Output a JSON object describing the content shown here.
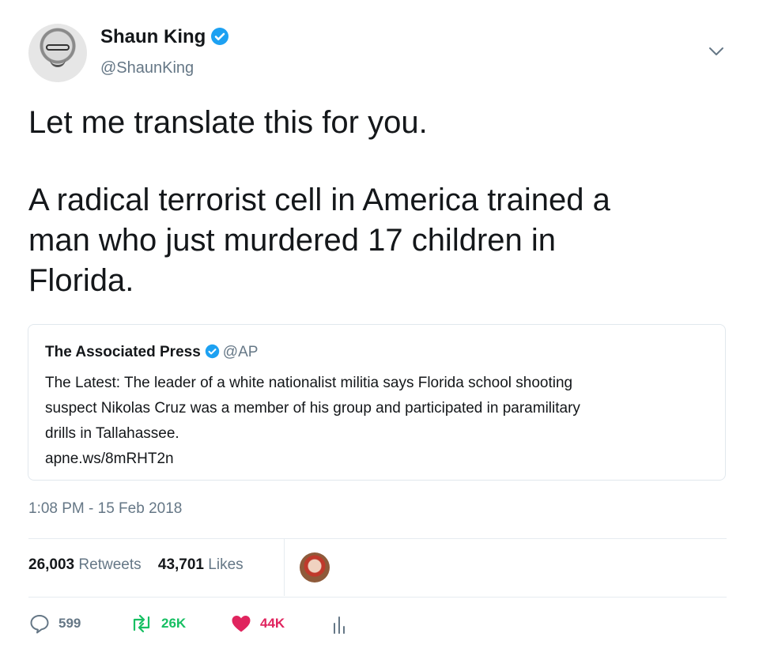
{
  "author": {
    "name": "Shaun King",
    "handle": "@ShaunKing"
  },
  "tweet": {
    "lines": [
      "Let me translate this for you.",
      "A radical terrorist cell in America trained a",
      "man who just murdered 17 children in",
      "Florida."
    ],
    "timestamp": "1:08 PM - 15 Feb 2018"
  },
  "quote": {
    "name": "The Associated Press",
    "handle": "@AP",
    "lines": [
      "The Latest: The leader of a white nationalist militia says Florida school shooting",
      "suspect Nikolas Cruz was a member of his group and participated in paramilitary",
      "drills in Tallahassee.",
      "apne.ws/8mRHT2n"
    ]
  },
  "stats": {
    "retweets_count": "26,003",
    "retweets_label": "Retweets",
    "likes_count": "43,701",
    "likes_label": "Likes"
  },
  "actions": {
    "replies": "599",
    "retweets": "26K",
    "likes": "44K"
  },
  "icons": {
    "verified": "verified-badge-icon",
    "caret": "chevron-down-icon",
    "reply": "reply-icon",
    "retweet": "retweet-icon",
    "like": "heart-icon",
    "analytics": "analytics-icon"
  },
  "colors": {
    "verified": "#1da1f2",
    "retweet": "#17bf63",
    "like": "#e0245e",
    "muted": "#657786"
  }
}
